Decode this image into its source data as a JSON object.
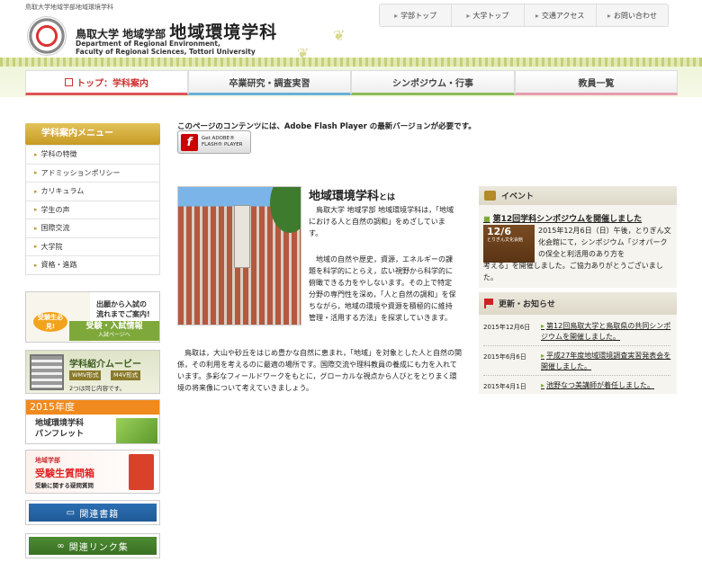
{
  "header": {
    "breadcrumb": "鳥取大学地域学部地域環境学科",
    "univ_faculty": "鳥取大学 地域学部",
    "dept_name": "地域環境学科",
    "dept_en_line1": "Department of Regional Environment,",
    "dept_en_line2": "Faculty of Regional Sciences, Tottori University"
  },
  "topnav": [
    "学部トップ",
    "大学トップ",
    "交通アクセス",
    "お問い合わせ"
  ],
  "mainnav": [
    "トップ：学科案内",
    "卒業研究・調査実習",
    "シンポジウム・行事",
    "教員一覧"
  ],
  "sidebar": {
    "menu_title": "学科案内メニュー",
    "items": [
      "学科の特徴",
      "アドミッションポリシー",
      "カリキュラム",
      "学生の声",
      "国際交流",
      "大学院",
      "資格・進路"
    ],
    "banner_admission": {
      "line1": "出願から入試の",
      "line2": "流れまでご案内!",
      "tag": "受験生必見!",
      "main": "受験・入試情報",
      "sub": "入試ページへ"
    },
    "banner_movie": {
      "title": "学科紹介ムービー",
      "format1": "WMV形式",
      "format2": "M4V形式",
      "note": "2つは同じ内容です。"
    },
    "banner_pamphlet": {
      "year": "2015年度",
      "line1": "地域環境学科",
      "line2": "パンフレット"
    },
    "banner_question": {
      "line1": "地域学部",
      "line2": "受験生質問箱",
      "line3": "受験に関する疑問質問"
    },
    "related_books": "関連書籍",
    "related_links": "関連リンク集"
  },
  "flash": {
    "message": "このページのコンテンツには、Adobe Flash Player の最新バージョンが必要です。",
    "button_line1": "Get ADOBE®",
    "button_line2": "FLASH® PLAYER",
    "icon": "flash-icon"
  },
  "intro": {
    "title": "地域環境学科",
    "title_suffix": "とは",
    "para1": "　鳥取大学 地域学部 地域環境学科は，「地域における人と自然の調和」をめざしています。",
    "para2": "　地域の自然や歴史，資源，エネルギーの課題を科学的にとらえ，広い視野から科学的に俯瞰できる力をやしないます。その上で特定分野の専門性を深め，「人と自然の調和」を保ちながら，地域の環境や資源を積極的に維持管理・活用する方法」を探求していきます。",
    "para3": "　鳥取は，大山や砂丘をはじめ豊かな自然に恵まれ，「地域」を対象とした人と自然の関係，その利用を考えるのに最適の場所です。国際交流や理科教員の養成にも力を入れています。多彩なフィールドワークをもとに，グローカルな視点から人びとをとりまく環境の将来像について考えていきましょう。"
  },
  "events": {
    "heading": "イベント",
    "link": "第12回学科シンポジウムを開催しました",
    "image_date": "12/6",
    "image_sub": "とりぎん文化会館",
    "text1": "2015年12月6日（日）午後，とりぎん文化会館にて，シンポジウム「ジオパークの保全と利活用のあり方を",
    "text2": "考える」を開催しました。ご協力ありがとうございました。"
  },
  "news": {
    "heading": "更新・お知らせ",
    "items": [
      {
        "date": "2015年12月6日",
        "title": "第12回鳥取大学と鳥取県の共同シンポジウムを開催しました。"
      },
      {
        "date": "2015年6月6日",
        "title": "平成27年度地域環境調査実習発表会を開催しました。"
      },
      {
        "date": "2015年4月1日",
        "title": "池野なつ美講師が着任しました。"
      }
    ]
  }
}
